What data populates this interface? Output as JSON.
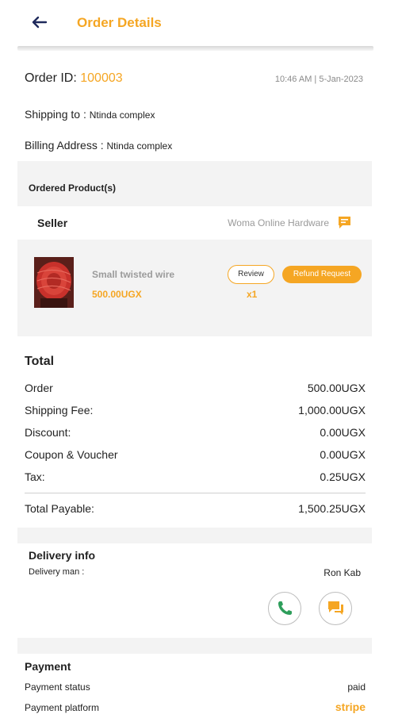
{
  "header": {
    "title": "Order Details"
  },
  "order": {
    "id_label": "Order ID:",
    "id_value": "100003",
    "timestamp": "10:46 AM | 5-Jan-2023"
  },
  "shipping": {
    "label": "Shipping to :",
    "value": "Ntinda complex"
  },
  "billing": {
    "label": "Billing Address :",
    "value": "Ntinda complex"
  },
  "ordered_products": {
    "title": "Ordered Product(s)",
    "seller_label": "Seller",
    "seller_name": "Woma Online Hardware",
    "product": {
      "name": "Small twisted wire",
      "price": "500.00UGX",
      "quantity": "x1",
      "review_label": "Review",
      "refund_label": "Refund Request"
    }
  },
  "total": {
    "title": "Total",
    "rows": [
      {
        "label": "Order",
        "value": "500.00UGX"
      },
      {
        "label": "Shipping Fee:",
        "value": "1,000.00UGX"
      },
      {
        "label": "Discount:",
        "value": "0.00UGX"
      },
      {
        "label": "Coupon & Voucher",
        "value": "0.00UGX"
      },
      {
        "label": "Tax:",
        "value": "0.25UGX"
      }
    ],
    "payable_label": "Total Payable:",
    "payable_value": "1,500.25UGX"
  },
  "delivery": {
    "title": "Delivery info",
    "man_label": "Delivery man :",
    "man_name": "Ron Kab",
    "icons": [
      "phone-icon",
      "chat-icon"
    ]
  },
  "payment": {
    "title": "Payment",
    "status_label": "Payment status",
    "status_value": "paid",
    "platform_label": "Payment platform",
    "platform_value": "stripe"
  },
  "colors": {
    "accent": "#f5a623",
    "back_arrow": "#1f2a5c",
    "phone_green": "#2e9e5b"
  }
}
